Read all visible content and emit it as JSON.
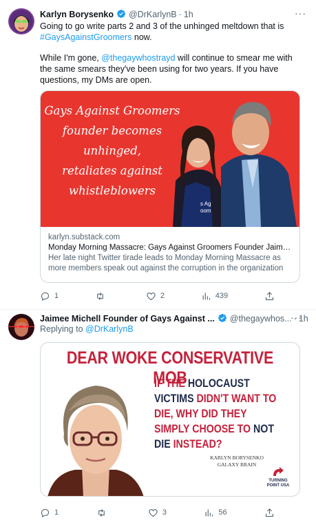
{
  "tweet1": {
    "author_name": "Karlyn Borysenko",
    "verified": true,
    "handle": "@DrKarlynB",
    "separator": "·",
    "time": "1h",
    "more_icon": "more-horizontal-icon",
    "text_line1": "Going to go write parts 2 and 3 of the unhinged meltdown that is",
    "hashtag": "#GaysAgainstGroomers",
    "text_after_hashtag": " now.",
    "text_p2_before_mention": "While I'm gone, ",
    "mention": "@thegaywhostrayd",
    "text_p2_after_mention": " will continue to smear me with the same smears they've been using for two years. If you have questions, my DMs are open.",
    "card": {
      "image_text_lines": [
        "Gays Against Groomers",
        "founder becomes",
        "unhinged,",
        "retaliates against",
        "whistleblowers"
      ],
      "image_background": "#e8362f",
      "domain": "karlyn.substack.com",
      "title": "Monday Morning Massacre: Gays Against Groomers Founder Jaimee...",
      "description": "Her late night Twitter tirade leads to Monday Morning Massacre as more members speak out against the corruption in the organization"
    },
    "actions": {
      "replies": "1",
      "retweets": "",
      "likes": "2",
      "views": "439"
    }
  },
  "tweet2": {
    "author_name": "Jaimee Michell Founder of Gays Against ...",
    "verified": true,
    "handle": "@thegaywhos...",
    "separator": "·",
    "time": "1h",
    "more_icon": "more-horizontal-icon",
    "replying_prefix": "Replying to ",
    "replying_to": "@DrKarlynB",
    "meme": {
      "title": "DEAR WOKE CONSERVATIVE MOB",
      "quote_parts": [
        {
          "text": "IF THE ",
          "color": "red"
        },
        {
          "text": "HOLOCAUST VICTIMS",
          "color": "dark"
        },
        {
          "text": " DIDN'T WANT TO DIE, WHY DID THEY SIMPLY CHOOSE TO ",
          "color": "red"
        },
        {
          "text": "NOT DIE",
          "color": "dark"
        },
        {
          "text": " INSTEAD?",
          "color": "red"
        }
      ],
      "credit_line1": "KARLYN BORYSENKO",
      "credit_line2": "GALAXY BRAIN",
      "logo_line1": "TURNING",
      "logo_line2": "POINT USA"
    },
    "actions": {
      "replies": "1",
      "retweets": "",
      "likes": "3",
      "views": "56"
    }
  },
  "colors": {
    "link": "#1d9bf0",
    "verified": "#1d9bf0",
    "meme_red": "#c4213b",
    "meme_dark": "#1e2a4a",
    "text_secondary": "#536471"
  }
}
